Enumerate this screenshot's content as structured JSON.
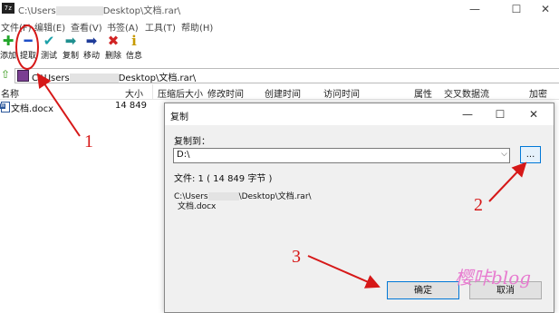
{
  "window": {
    "app_icon_text": "7z",
    "title_prefix": "C:\\Users",
    "title_suffix": "Desktop\\文档.rar\\",
    "min_glyph": "—",
    "max_glyph": "☐",
    "close_glyph": "✕"
  },
  "menu": [
    {
      "label": "文件(F)"
    },
    {
      "label": "编辑(E)"
    },
    {
      "label": "查看(V)"
    },
    {
      "label": "书签(A)"
    },
    {
      "label": "工具(T)"
    },
    {
      "label": "帮助(H)"
    }
  ],
  "toolbar": [
    {
      "label": "添加",
      "icon": "add-icon",
      "glyph": "✚",
      "color": "#22a52a"
    },
    {
      "label": "提取",
      "icon": "extract-icon",
      "glyph": "━",
      "color": "#1f4fc7"
    },
    {
      "label": "测试",
      "icon": "test-icon",
      "glyph": "✔",
      "color": "#1aa0a8"
    },
    {
      "label": "复制",
      "icon": "copy-icon",
      "glyph": "➡",
      "color": "#1f8f8f"
    },
    {
      "label": "移动",
      "icon": "move-icon",
      "glyph": "➡",
      "color": "#1f3c99"
    },
    {
      "label": "删除",
      "icon": "delete-icon",
      "glyph": "✖",
      "color": "#d12424"
    },
    {
      "label": "信息",
      "icon": "info-icon",
      "glyph": "i",
      "color": "#c79a00"
    }
  ],
  "address": {
    "prefix": "C:\\Users",
    "suffix": "Desktop\\文档.rar\\"
  },
  "columns": [
    "名称",
    "大小",
    "压缩后大小",
    "修改时间",
    "创建时间",
    "访问时间",
    "属性",
    "交叉数据流",
    "加密"
  ],
  "files": [
    {
      "name": "文档.docx",
      "size": "14 849"
    }
  ],
  "dialog": {
    "title": "复制",
    "copy_to_label": "复制到：",
    "destination": "D:\\",
    "browse_label": "...",
    "files_info": "文件: 1   ( 14 849 字节 )",
    "source_prefix": "C:\\Users",
    "source_suffix": "\\Desktop\\文档.rar\\",
    "source_file": "文档.docx",
    "ok_label": "确定",
    "cancel_label": "取消"
  },
  "annotations": {
    "color": "#d61818",
    "step1": "1",
    "step2": "2",
    "step3": "3"
  },
  "watermark": "樱咔blog"
}
